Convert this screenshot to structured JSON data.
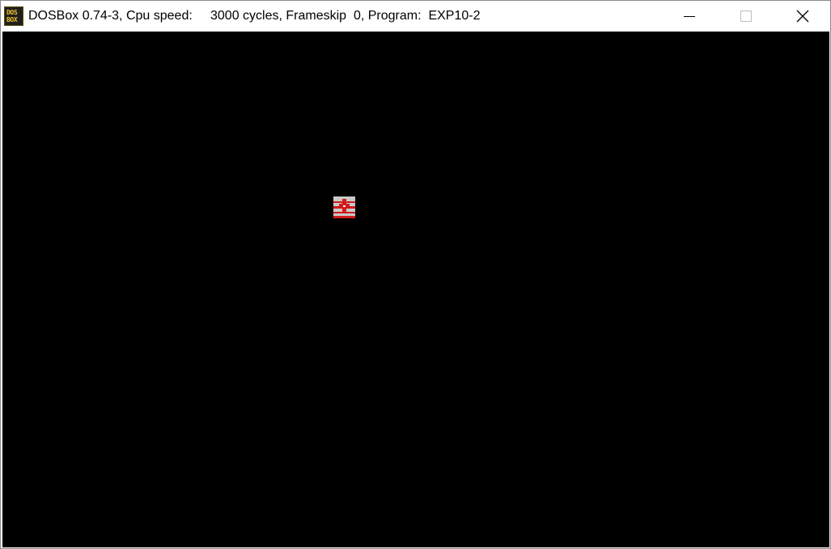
{
  "window": {
    "app_icon": {
      "icon": "dosbox-icon",
      "line1": "DOS",
      "line2": "BOX",
      "fg_color": "#f2c12e",
      "bg_color": "#1f1f1f"
    },
    "title": "DOSBox 0.74-3, Cpu speed:     3000 cycles, Frameskip  0, Program:  EXP10-2",
    "controls": {
      "minimize_icon": "minimize-icon",
      "maximize_icon": "maximize-icon",
      "close_icon": "close-icon"
    }
  },
  "dos_screen": {
    "background_color": "#000000",
    "sprite": {
      "icon": "red-cross-sprite-icon",
      "colors": {
        "base": "#c9c9c9",
        "accent": "#d31a1a"
      }
    }
  }
}
